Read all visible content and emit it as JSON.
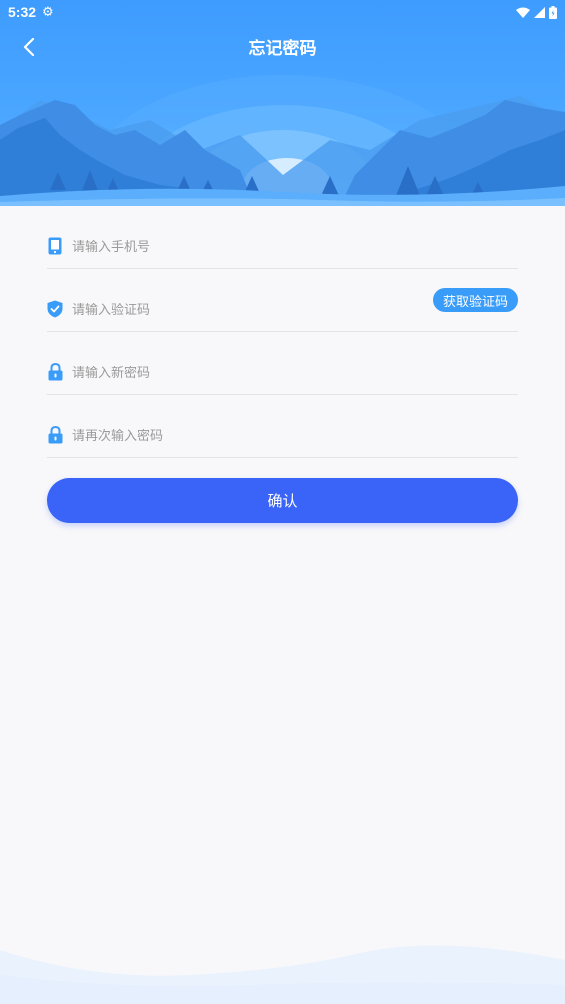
{
  "status_bar": {
    "time": "5:32"
  },
  "header": {
    "title": "忘记密码"
  },
  "form": {
    "phone_placeholder": "请输入手机号",
    "code_placeholder": "请输入验证码",
    "get_code_label": "获取验证码",
    "new_password_placeholder": "请输入新密码",
    "confirm_password_placeholder": "请再次输入密码",
    "confirm_label": "确认"
  },
  "colors": {
    "header_blue": "#3e9cff",
    "accent_blue": "#3a9cf9",
    "button_blue": "#3a63f7",
    "background": "#f8f8fa"
  },
  "icons": [
    "back-arrow-icon",
    "settings-gear-icon",
    "wifi-icon",
    "signal-icon",
    "battery-icon",
    "phone-icon",
    "shield-check-icon",
    "lock-icon"
  ]
}
